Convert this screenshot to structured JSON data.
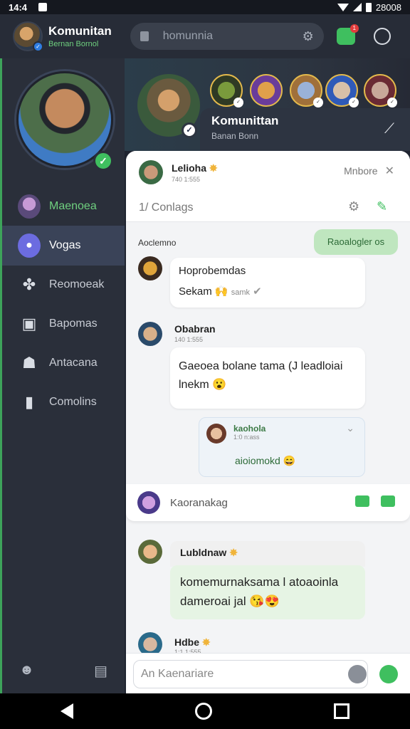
{
  "status": {
    "time": "14:4",
    "battery": "28008"
  },
  "app": {
    "title": "Komunitan",
    "subtitle": "Bernan Bornol"
  },
  "search": {
    "placeholder": "homunnia"
  },
  "notifications": {
    "count": "1"
  },
  "sidebar": {
    "items": [
      {
        "label": "Maenoea",
        "icon": "user-avatar-icon"
      },
      {
        "label": "Vogas",
        "icon": "person-icon"
      },
      {
        "label": "Reomoeak",
        "icon": "puzzle-icon"
      },
      {
        "label": "Bapomas",
        "icon": "calendar-icon"
      },
      {
        "label": "Antacana",
        "icon": "contacts-icon"
      },
      {
        "label": "Comolins",
        "icon": "clipboard-icon"
      }
    ]
  },
  "banner": {
    "title": "Komunittan",
    "subtitle": "Banan Bonn"
  },
  "panel": {
    "header": {
      "name": "Lelioha",
      "sub": "740 1:555",
      "right": "Mnbore"
    },
    "sub_bar": {
      "label": "1/ Conlags"
    },
    "sender": "Aoclemno",
    "chip": "Raoalogler os",
    "msg1": {
      "line1": "Hoprobemdas",
      "line2": "Sekam",
      "tag": "samk"
    },
    "msg2": {
      "name": "Obabran",
      "sub": "140 1:555",
      "text": "Gaeoea bolane tama (J leadloiai lnekm"
    },
    "quote": {
      "name": "kaohola",
      "sub": "1:0 n:ass",
      "text": "aioiomokd"
    },
    "composer_top": {
      "placeholder": "Kaoranakag"
    },
    "msg3": {
      "name": "Lubldnaw",
      "text": "komemurnaksama l atoaoinla dameroai jal"
    },
    "msg4": {
      "name": "Hdbe",
      "sub": "1:1 1:555"
    },
    "composer_bottom": {
      "placeholder": "An Kaenariare"
    }
  }
}
